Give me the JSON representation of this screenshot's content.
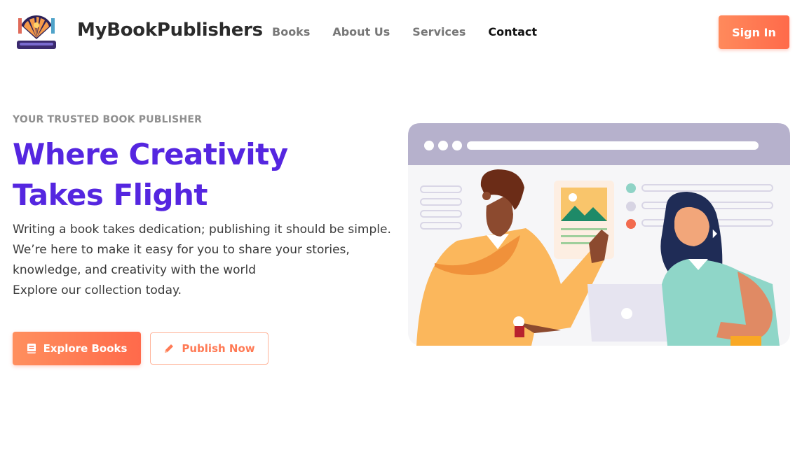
{
  "brand": {
    "name": "MyBookPublishers"
  },
  "nav": {
    "links": [
      {
        "label": "Books"
      },
      {
        "label": "About Us"
      },
      {
        "label": "Services"
      },
      {
        "label": "Contact"
      }
    ],
    "signin_label": "Sign In"
  },
  "hero": {
    "eyebrow": "YOUR TRUSTED BOOK PUBLISHER",
    "headline": [
      "Where Creativity",
      "Takes Flight"
    ],
    "description": [
      "Writing a book takes dedication; publishing it should be simple.",
      "We’re here to make it easy for you to share your stories,",
      "knowledge, and creativity with the world",
      "Explore our collection today."
    ],
    "primary_button": {
      "label": "Explore Books",
      "icon": "book-icon"
    },
    "secondary_button": {
      "label": "Publish Now",
      "icon": "pencil-icon"
    }
  },
  "colors": {
    "accent_orange": "#ff7a55",
    "headline_purple": "#5526e0",
    "browser_bar": "#b6b1cc"
  }
}
